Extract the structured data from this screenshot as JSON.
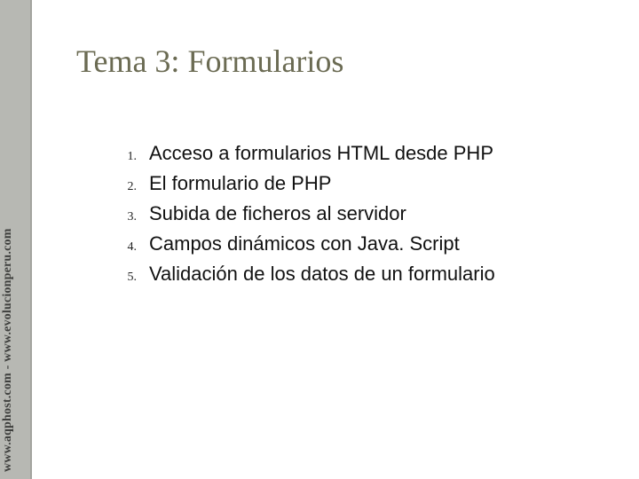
{
  "sidebar": {
    "label": "www.aqphost.com - www.evolucionperu.com"
  },
  "title": "Tema 3: Formularios",
  "list": {
    "items": [
      {
        "num": "1.",
        "text": "Acceso a formularios HTML desde PHP"
      },
      {
        "num": "2.",
        "text": "El formulario de PHP"
      },
      {
        "num": "3.",
        "text": "Subida de ficheros al servidor"
      },
      {
        "num": "4.",
        "text": "Campos dinámicos con Java. Script"
      },
      {
        "num": "5.",
        "text": "Validación de los datos de un formulario"
      }
    ]
  }
}
